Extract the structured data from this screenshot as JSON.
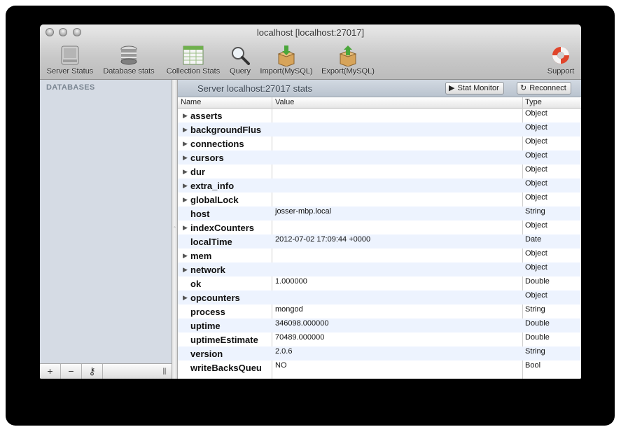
{
  "window": {
    "title": "localhost [localhost:27017]"
  },
  "toolbar": {
    "items": [
      {
        "label": "Server Status",
        "icon": "server-icon"
      },
      {
        "label": "Database stats",
        "icon": "database-icon"
      },
      {
        "label": "Collection Stats",
        "icon": "spreadsheet-icon"
      },
      {
        "label": "Query",
        "icon": "magnifier-icon"
      },
      {
        "label": "Import(MySQL)",
        "icon": "import-box-icon"
      },
      {
        "label": "Export(MySQL)",
        "icon": "export-box-icon"
      },
      {
        "label": "Support",
        "icon": "lifebuoy-icon"
      }
    ]
  },
  "sidebar": {
    "heading": "DATABASES",
    "buttons": {
      "add": "+",
      "remove": "−",
      "key": "⚷",
      "grip": "|||"
    }
  },
  "main": {
    "title": "Server localhost:27017 stats",
    "stat_monitor_label": "Stat Monitor",
    "reconnect_label": "Reconnect",
    "columns": {
      "name": "Name",
      "value": "Value",
      "type": "Type"
    },
    "rows": [
      {
        "name": "asserts",
        "value": "",
        "type": "Object",
        "expandable": true
      },
      {
        "name": "backgroundFlus",
        "value": "",
        "type": "Object",
        "expandable": true
      },
      {
        "name": "connections",
        "value": "",
        "type": "Object",
        "expandable": true
      },
      {
        "name": "cursors",
        "value": "",
        "type": "Object",
        "expandable": true
      },
      {
        "name": "dur",
        "value": "",
        "type": "Object",
        "expandable": true
      },
      {
        "name": "extra_info",
        "value": "",
        "type": "Object",
        "expandable": true
      },
      {
        "name": "globalLock",
        "value": "",
        "type": "Object",
        "expandable": true
      },
      {
        "name": "host",
        "value": "josser-mbp.local",
        "type": "String",
        "expandable": false
      },
      {
        "name": "indexCounters",
        "value": "",
        "type": "Object",
        "expandable": true
      },
      {
        "name": "localTime",
        "value": "2012-07-02 17:09:44 +0000",
        "type": "Date",
        "expandable": false
      },
      {
        "name": "mem",
        "value": "",
        "type": "Object",
        "expandable": true
      },
      {
        "name": "network",
        "value": "",
        "type": "Object",
        "expandable": true
      },
      {
        "name": "ok",
        "value": "1.000000",
        "type": "Double",
        "expandable": false
      },
      {
        "name": "opcounters",
        "value": "",
        "type": "Object",
        "expandable": true
      },
      {
        "name": "process",
        "value": "mongod",
        "type": "String",
        "expandable": false
      },
      {
        "name": "uptime",
        "value": "346098.000000",
        "type": "Double",
        "expandable": false
      },
      {
        "name": "uptimeEstimate",
        "value": "70489.000000",
        "type": "Double",
        "expandable": false
      },
      {
        "name": "version",
        "value": "2.0.6",
        "type": "String",
        "expandable": false
      },
      {
        "name": "writeBacksQueu",
        "value": "NO",
        "type": "Bool",
        "expandable": false
      }
    ]
  },
  "colors": {
    "sidebar": "#d5dbe4",
    "row_alt": "#edf3fe",
    "header": "#b9c3ce"
  }
}
